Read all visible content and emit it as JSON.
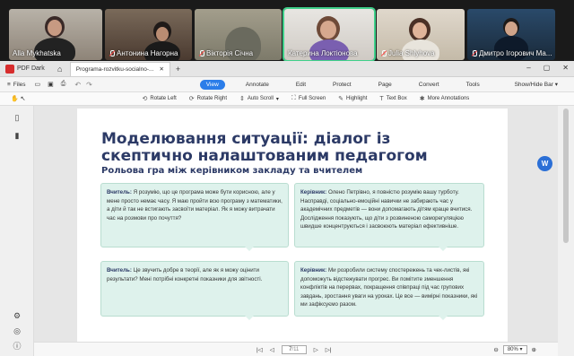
{
  "participants": [
    {
      "name": "Alla Mykhatska",
      "muted": false
    },
    {
      "name": "Антонина Нагорна",
      "muted": true
    },
    {
      "name": "Вікторія Січна",
      "muted": true
    },
    {
      "name": "Катерина Локтіонова",
      "muted": false
    },
    {
      "name": "Julia Shlyhova",
      "muted": true
    },
    {
      "name": "Дмитро Ігорович Ма...",
      "muted": true
    }
  ],
  "window": {
    "app_name": "PDF Dark",
    "doc_tab": "Programa-rozvitku-socialno-...",
    "controls": [
      "–",
      "▢",
      "✕"
    ]
  },
  "toolbar1": {
    "files": "Files",
    "tabs": [
      "View",
      "Annotate",
      "Edit",
      "Protect",
      "Page",
      "Convert",
      "Tools"
    ],
    "selected_tab": "View",
    "showhide": "Show/Hide Bar"
  },
  "toolbar2": {
    "tools": [
      "Rotate Left",
      "Rotate Right",
      "Auto Scroll",
      "Full Screen",
      "Highlight",
      "Text Box",
      "More Annotations"
    ]
  },
  "document": {
    "title_line1": "Моделювання ситуації: діалог із",
    "title_line2": "скептично налаштованим педагогом",
    "subtitle": "Рольова гра між керівником закладу та вчителем",
    "bubbles": [
      {
        "speaker": "Вчитель:",
        "text": "Я розумію, що це програма може бути корисною, але у мене просто немає часу. Я маю пройти всю програму з математики, а діти й так не встигають засвоїти матеріал. Як я можу витрачати час на розмови про почуття?"
      },
      {
        "speaker": "Керівник:",
        "text": "Олено Петрівно, я повністю розумію вашу турботу. Насправді, соціально-емоційні навички не забирають час у академічних предметів — вони допомагають дітям краще вчитися. Дослідження показують, що діти з розвиненою саморегуляцією швидше концентруються і засвоюють матеріал ефективніше."
      },
      {
        "speaker": "Вчитель:",
        "text": "Це звучить добре в теорії, але як я можу оцінити результати? Мені потрібні конкретні показники для звітності."
      },
      {
        "speaker": "Керівник:",
        "text": "Ми розробили систему спостережень та чек-листів, які допоможуть відстежувати прогрес. Ви помітите зменшення конфліктів на перервах, покращення співпраці під час групових завдань, зростання уваги на уроках. Це все — вимірні показники, які ми зафіксуємо разом."
      }
    ]
  },
  "status": {
    "page_value": "7",
    "page_total": "/11",
    "zoom": "80%"
  },
  "avatar_letter": "W"
}
